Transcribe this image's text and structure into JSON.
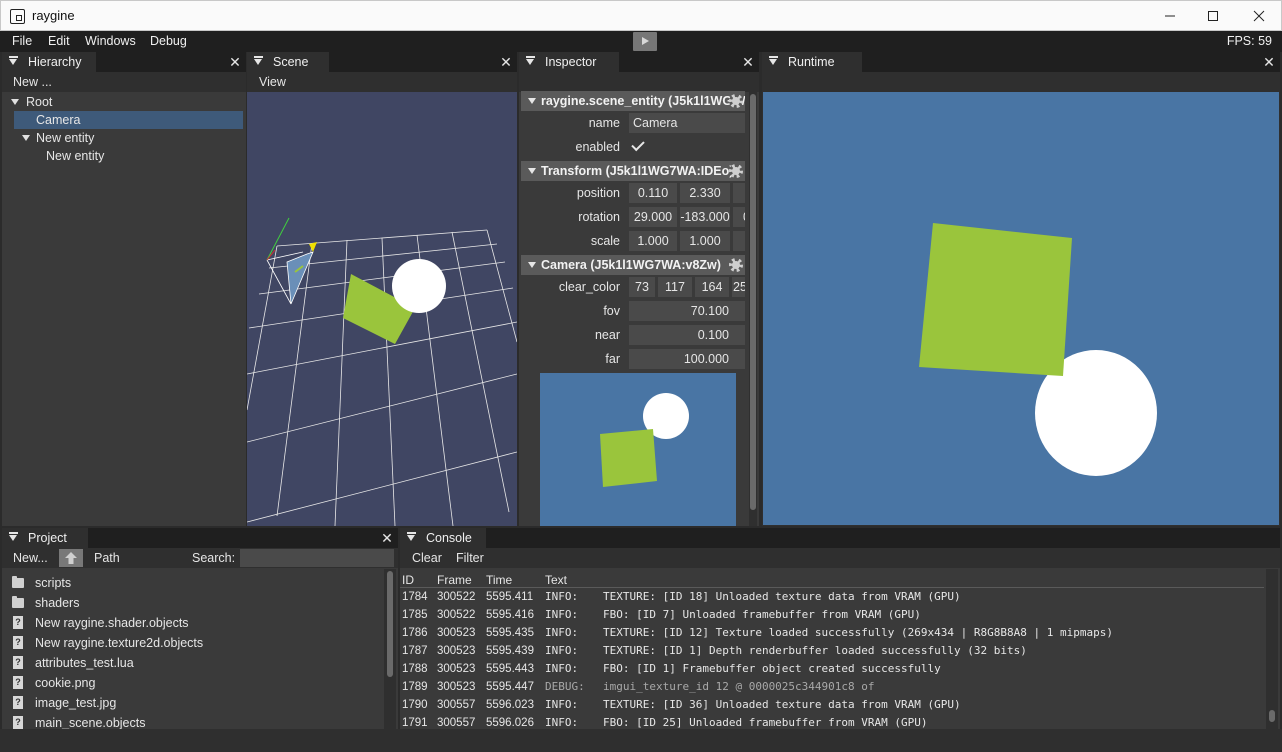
{
  "window": {
    "title": "raygine"
  },
  "menubar": {
    "items": [
      "File",
      "Edit",
      "Windows",
      "Debug"
    ],
    "fps": "FPS: 59"
  },
  "hierarchy": {
    "tab": "Hierarchy",
    "new_label": "New ...",
    "items": [
      {
        "label": "Root",
        "depth": 0,
        "expanded": true,
        "selected": false
      },
      {
        "label": "Camera",
        "depth": 1,
        "expanded": false,
        "selected": true
      },
      {
        "label": "New entity",
        "depth": 1,
        "expanded": true,
        "selected": false
      },
      {
        "label": "New entity",
        "depth": 2,
        "expanded": false,
        "selected": false
      }
    ]
  },
  "scene": {
    "tab": "Scene",
    "view_menu": "View"
  },
  "inspector": {
    "tab": "Inspector",
    "entity_header": "raygine.scene_entity (J5k1l1WG7WA",
    "name_label": "name",
    "name_value": "Camera",
    "enabled_label": "enabled",
    "transform_header": "Transform (J5k1l1WG7WA:IDEo)",
    "position_label": "position",
    "position": [
      "0.110",
      "2.330"
    ],
    "rotation_label": "rotation",
    "rotation": [
      "29.000",
      "-183.000",
      "0"
    ],
    "scale_label": "scale",
    "scale": [
      "1.000",
      "1.000"
    ],
    "camera_header": "Camera (J5k1l1WG7WA:v8Zw)",
    "clear_color_label": "clear_color",
    "clear_color": [
      "73",
      "117",
      "164",
      "25"
    ],
    "fov_label": "fov",
    "fov": "70.100",
    "near_label": "near",
    "near": "0.100",
    "far_label": "far",
    "far": "100.000"
  },
  "runtime": {
    "tab": "Runtime"
  },
  "project": {
    "tab": "Project",
    "new_label": "New...",
    "path_label": "Path",
    "search_label": "Search:",
    "search_value": "",
    "items": [
      {
        "name": "scripts",
        "kind": "folder"
      },
      {
        "name": "shaders",
        "kind": "folder"
      },
      {
        "name": "New raygine.shader.objects",
        "kind": "file"
      },
      {
        "name": "New raygine.texture2d.objects",
        "kind": "file"
      },
      {
        "name": "attributes_test.lua",
        "kind": "file"
      },
      {
        "name": "cookie.png",
        "kind": "file"
      },
      {
        "name": "image_test.jpg",
        "kind": "file"
      },
      {
        "name": "main_scene.objects",
        "kind": "file"
      }
    ]
  },
  "console": {
    "tab": "Console",
    "clear_label": "Clear",
    "filter_label": "Filter",
    "columns": [
      "ID",
      "Frame",
      "Time",
      "Text"
    ],
    "rows": [
      {
        "id": "1784",
        "frame": "300522",
        "time": "5595.411",
        "level": "INFO:",
        "text": "TEXTURE: [ID 18] Unloaded texture data from VRAM (GPU)"
      },
      {
        "id": "1785",
        "frame": "300522",
        "time": "5595.416",
        "level": "INFO:",
        "text": "FBO: [ID 7] Unloaded framebuffer from VRAM (GPU)"
      },
      {
        "id": "1786",
        "frame": "300523",
        "time": "5595.435",
        "level": "INFO:",
        "text": "TEXTURE: [ID 12] Texture loaded successfully (269x434 | R8G8B8A8 | 1 mipmaps)"
      },
      {
        "id": "1787",
        "frame": "300523",
        "time": "5595.439",
        "level": "INFO:",
        "text": "TEXTURE: [ID 1] Depth renderbuffer loaded successfully (32 bits)"
      },
      {
        "id": "1788",
        "frame": "300523",
        "time": "5595.443",
        "level": "INFO:",
        "text": "FBO: [ID 1] Framebuffer object created successfully"
      },
      {
        "id": "1789",
        "frame": "300523",
        "time": "5595.447",
        "level": "DEBUG:",
        "text": "imgui_texture_id 12 @ 0000025c344901c8 of"
      },
      {
        "id": "1790",
        "frame": "300557",
        "time": "5596.023",
        "level": "INFO:",
        "text": "TEXTURE: [ID 36] Unloaded texture data from VRAM (GPU)"
      },
      {
        "id": "1791",
        "frame": "300557",
        "time": "5596.026",
        "level": "INFO:",
        "text": "FBO: [ID 25] Unloaded framebuffer from VRAM (GPU)"
      }
    ]
  },
  "colors": {
    "sky": "#4975a4",
    "green": "#9ac53c",
    "scene_bg": "#404663",
    "selection": "#3e5a7a"
  }
}
